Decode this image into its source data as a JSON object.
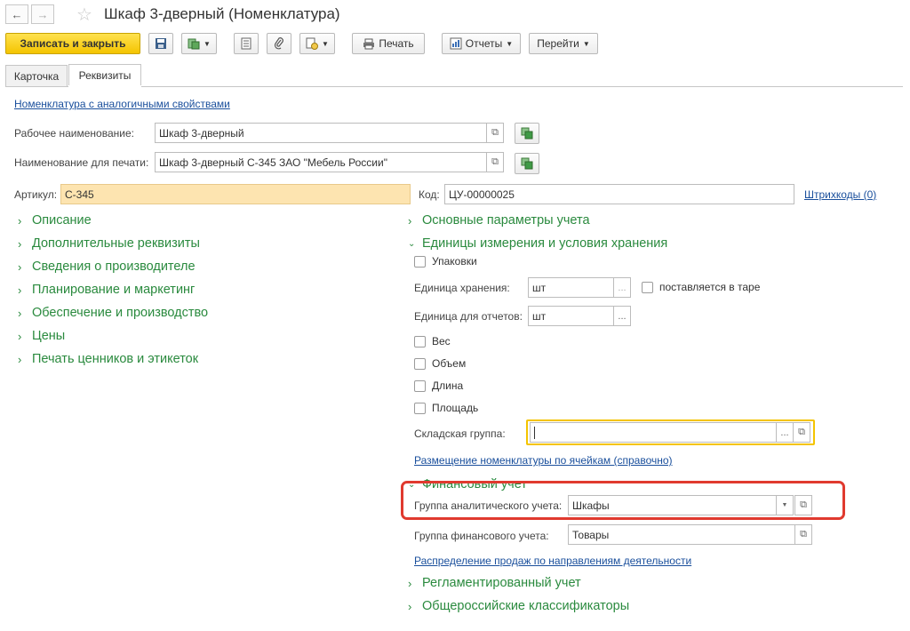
{
  "window": {
    "title": "Шкаф 3-дверный (Номенклатура)"
  },
  "toolbar": {
    "save_close": "Записать и закрыть",
    "print": "Печать",
    "reports": "Отчеты",
    "goto": "Перейти"
  },
  "tabs": [
    {
      "label": "Карточка"
    },
    {
      "label": "Реквизиты"
    }
  ],
  "links": {
    "similar": "Номенклатура с аналогичными свойствами",
    "barcodes": "Штрихкоды (0)",
    "cells": "Размещение номенклатуры по ячейкам (справочно)",
    "distribution": "Распределение продаж по направлениям деятельности"
  },
  "fields": {
    "work_name_label": "Рабочее наименование:",
    "work_name_value": "Шкаф 3-дверный",
    "print_name_label": "Наименование для печати:",
    "print_name_value": "Шкаф 3-дверный С-345 ЗАО \"Мебель России\"",
    "article_label": "Артикул:",
    "article_value": "С-345",
    "code_label": "Код:",
    "code_value": "ЦУ-00000025"
  },
  "left_sections": [
    {
      "label": "Описание"
    },
    {
      "label": "Дополнительные реквизиты"
    },
    {
      "label": "Сведения о производителе"
    },
    {
      "label": "Планирование и маркетинг"
    },
    {
      "label": "Обеспечение и производство"
    },
    {
      "label": "Цены"
    },
    {
      "label": "Печать ценников и этикеток"
    }
  ],
  "right": {
    "main_params": "Основные параметры учета",
    "units_section": "Единицы измерения и условия хранения",
    "packages": "Упаковки",
    "storage_unit_label": "Единица хранения:",
    "storage_unit_value": "шт",
    "in_container": "поставляется в таре",
    "report_unit_label": "Единица для отчетов:",
    "report_unit_value": "шт",
    "weight": "Вес",
    "volume": "Объем",
    "length": "Длина",
    "area": "Площадь",
    "warehouse_group_label": "Складская группа:",
    "warehouse_group_value": "",
    "finance_section": "Финансовый учет",
    "analytic_group_label": "Группа аналитического учета:",
    "analytic_group_value": "Шкафы",
    "finance_group_label": "Группа финансового учета:",
    "finance_group_value": "Товары",
    "regulated": "Регламентированный учет",
    "classifiers": "Общероссийские классификаторы"
  },
  "colors": {
    "accent_yellow": "#f4c400",
    "section_green": "#2a8a3e",
    "link_blue": "#1a4f9c",
    "highlight_red": "#e03a2f"
  }
}
